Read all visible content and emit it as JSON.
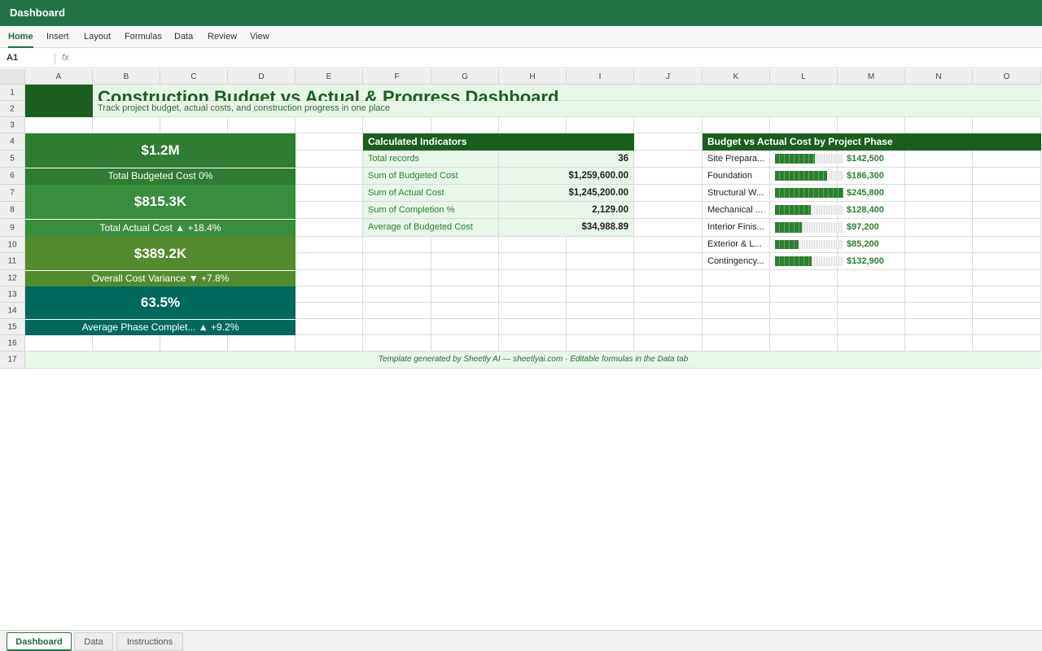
{
  "app": {
    "title": "Dashboard"
  },
  "ribbon": {
    "tabs": [
      "Home",
      "Insert",
      "Layout",
      "Formulas",
      "Data",
      "Review",
      "View"
    ],
    "active": "Home"
  },
  "formula_bar": {
    "cell_ref": "A1",
    "fx_label": "fx",
    "content": ""
  },
  "grid": {
    "columns": [
      "A",
      "B",
      "C",
      "D",
      "E",
      "F",
      "G",
      "H",
      "I",
      "J",
      "K",
      "L",
      "M",
      "N",
      "O"
    ],
    "rows": [
      "1",
      "2",
      "3",
      "4",
      "5",
      "6",
      "7",
      "8",
      "9",
      "10",
      "11",
      "12",
      "13",
      "14",
      "15",
      "16",
      "17"
    ]
  },
  "dashboard": {
    "title": "Construction Budget vs Actual & Progress Dashboard",
    "subtitle": "Track project budget, actual costs, and construction progress in one place",
    "kpis": [
      {
        "value": "$1.2M",
        "label": "Total Budgeted Cost 0%",
        "color": "#2e7d32"
      },
      {
        "value": "$815.3K",
        "label": "Total Actual Cost ▲ +18.4%",
        "color": "#388e3c"
      },
      {
        "value": "$389.2K",
        "label": "Overall Cost Variance ▼ +7.8%",
        "color": "#558b2f"
      },
      {
        "value": "63.5%",
        "label": "Average Phase Complet... ▲ +9.2%",
        "color": "#00695c"
      }
    ],
    "indicators": {
      "header": "Calculated Indicators",
      "rows": [
        {
          "label": "Total records",
          "value": "36"
        },
        {
          "label": "Sum of Budgeted Cost",
          "value": "$1,259,600.00"
        },
        {
          "label": "Sum of Actual Cost",
          "value": "$1,245,200.00"
        },
        {
          "label": "Sum of Completion %",
          "value": "2,129.00"
        },
        {
          "label": "Average of Budgeted Cost",
          "value": "$34,988.89"
        }
      ]
    },
    "phases": {
      "header": "Budget vs Actual Cost by Project Phase",
      "items": [
        {
          "label": "Site Prepara...",
          "value": 142500,
          "display": "$142,500"
        },
        {
          "label": "Foundation",
          "value": 186300,
          "display": "$186,300"
        },
        {
          "label": "Structural W...",
          "value": 245800,
          "display": "$245,800"
        },
        {
          "label": "Mechanical ...",
          "value": 128400,
          "display": "$128,400"
        },
        {
          "label": "Interior Finis...",
          "value": 97200,
          "display": "$97,200"
        },
        {
          "label": "Exterior & L...",
          "value": 85200,
          "display": "$85,200"
        },
        {
          "label": "Contingency...",
          "value": 132900,
          "display": "$132,900"
        }
      ]
    },
    "footer": "Template generated by Sheetly AI — sheetlyai.com · Editable formulas in the Data tab"
  },
  "sheet_tabs": [
    "Dashboard",
    "Data",
    "Instructions"
  ],
  "active_sheet": "Dashboard"
}
